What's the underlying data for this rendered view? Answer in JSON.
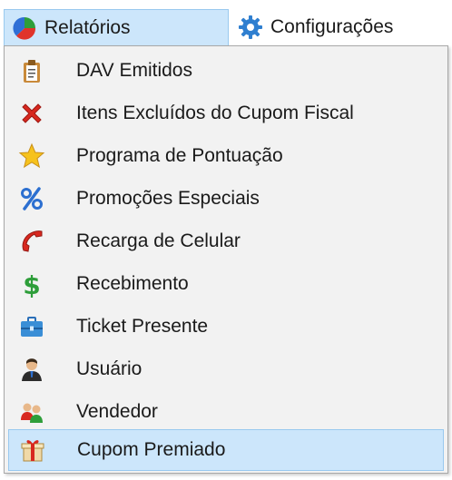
{
  "menubar": {
    "reports_label": "Relatórios",
    "reports_icon": "pie-chart-icon",
    "config_label": "Configurações",
    "config_icon": "gear-icon"
  },
  "dropdown": {
    "items": [
      {
        "label": "DAV Emitidos",
        "icon": "clipboard-document-icon"
      },
      {
        "label": "Itens Excluídos do Cupom Fiscal",
        "icon": "red-x-icon"
      },
      {
        "label": "Programa de Pontuação",
        "icon": "star-icon"
      },
      {
        "label": "Promoções Especiais",
        "icon": "percent-icon"
      },
      {
        "label": "Recarga de Celular",
        "icon": "phone-handset-icon"
      },
      {
        "label": "Recebimento",
        "icon": "dollar-sign-icon"
      },
      {
        "label": "Ticket Presente",
        "icon": "briefcase-icon"
      },
      {
        "label": "Usuário",
        "icon": "user-icon"
      },
      {
        "label": "Vendedor",
        "icon": "users-group-icon"
      },
      {
        "label": "Cupom Premiado",
        "icon": "gift-icon",
        "selected": true
      }
    ]
  },
  "colors": {
    "selection_bg": "#cce6fb",
    "selection_border": "#99c9ef",
    "menu_bg": "#f2f2f2"
  }
}
